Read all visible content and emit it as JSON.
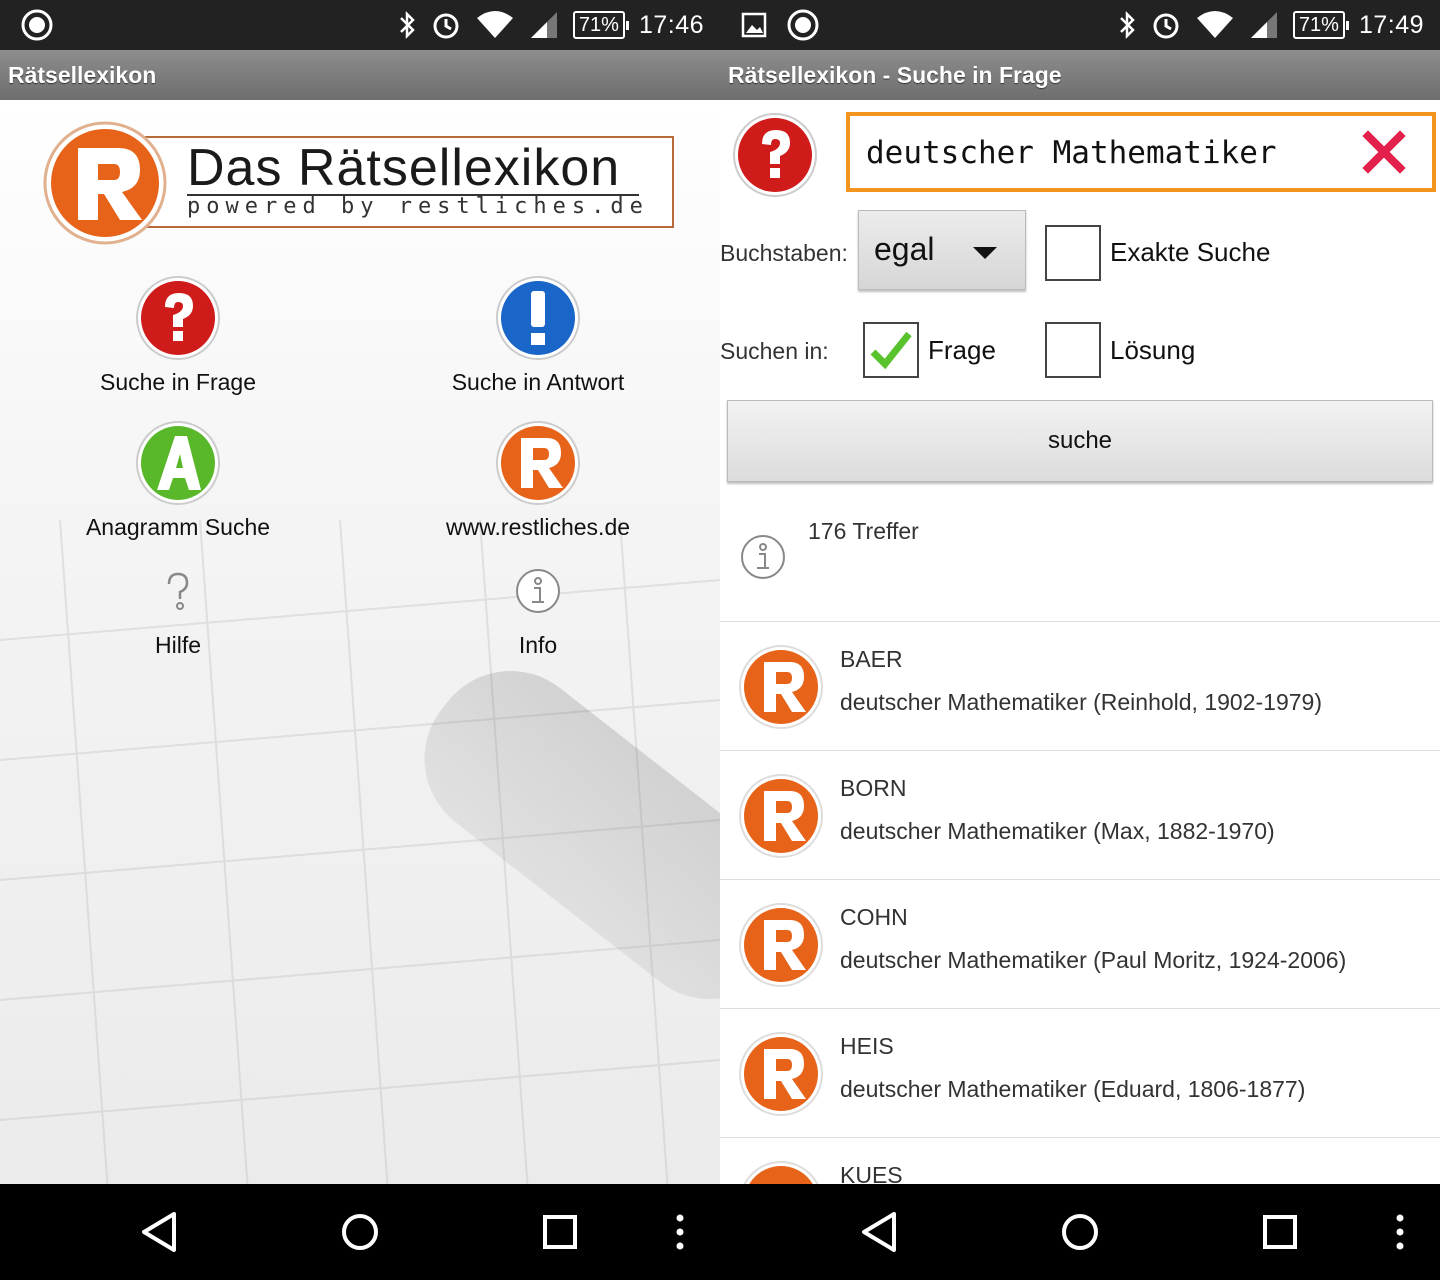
{
  "left": {
    "status": {
      "time": "17:46",
      "battery": "71%"
    },
    "title": "Rätsellexikon",
    "logo": {
      "title": "Das Rätsellexikon",
      "subtitle": "powered by restliches.de"
    },
    "menu": [
      {
        "label": "Suche in Frage",
        "icon": "question-red-icon"
      },
      {
        "label": "Suche in Antwort",
        "icon": "exclamation-blue-icon"
      },
      {
        "label": "Anagramm Suche",
        "icon": "anagram-green-icon"
      },
      {
        "label": "www.restliches.de",
        "icon": "restliches-logo-icon"
      },
      {
        "label": "Hilfe",
        "icon": "help-icon"
      },
      {
        "label": "Info",
        "icon": "info-icon"
      }
    ]
  },
  "right": {
    "status": {
      "time": "17:49",
      "battery": "71%"
    },
    "title": "Rätsellexikon - Suche in Frage",
    "search": {
      "value": "deutscher Mathematiker"
    },
    "letters_label": "Buchstaben:",
    "letters_value": "egal",
    "exact_label": "Exakte Suche",
    "search_in_label": "Suchen in:",
    "question_label": "Frage",
    "question_checked": true,
    "solution_label": "Lösung",
    "button_label": "suche",
    "hits": "176 Treffer",
    "results": [
      {
        "word": "BAER",
        "desc": "deutscher Mathematiker (Reinhold, 1902-1979)"
      },
      {
        "word": "BORN",
        "desc": "deutscher Mathematiker (Max, 1882-1970)"
      },
      {
        "word": "COHN",
        "desc": "deutscher Mathematiker (Paul Moritz, 1924-2006)"
      },
      {
        "word": "HEIS",
        "desc": "deutscher Mathematiker (Eduard, 1806-1877)"
      },
      {
        "word": "KUES",
        "desc": ""
      }
    ]
  },
  "colors": {
    "accent": "#f3941f",
    "brand_orange": "#e8631a",
    "red": "#d01b1b",
    "blue": "#1a66c8",
    "green": "#59b82a"
  }
}
